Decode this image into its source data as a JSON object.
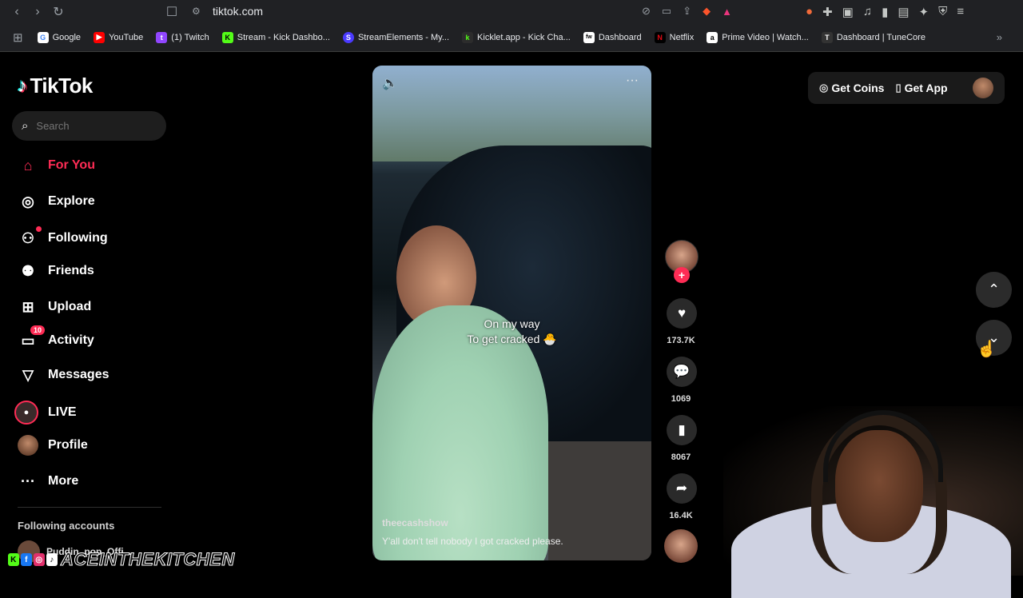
{
  "browser": {
    "url": "tiktok.com",
    "bookmarks": [
      {
        "label": "Google",
        "color": "#4285f4",
        "glyph": "G"
      },
      {
        "label": "YouTube",
        "color": "#ff0000",
        "glyph": "▶"
      },
      {
        "label": "(1) Twitch",
        "color": "#9146ff",
        "glyph": "t"
      },
      {
        "label": "Stream - Kick Dashbo...",
        "color": "#53fc18",
        "glyph": "K"
      },
      {
        "label": "StreamElements - My...",
        "color": "#4a3aff",
        "glyph": "S"
      },
      {
        "label": "Kicklet.app - Kick Cha...",
        "color": "#2c2c2c",
        "glyph": "k"
      },
      {
        "label": "Dashboard",
        "color": "#ffffff",
        "glyph": "fw"
      },
      {
        "label": "Netflix",
        "color": "#e50914",
        "glyph": "N"
      },
      {
        "label": "Prime Video | Watch...",
        "color": "#ffffff",
        "glyph": "a"
      },
      {
        "label": "Dashboard | TuneCore",
        "color": "#333333",
        "glyph": "T"
      }
    ]
  },
  "tiktok": {
    "logo": "TikTok",
    "search_placeholder": "Search",
    "nav": [
      {
        "label": "For You",
        "icon": "home-icon"
      },
      {
        "label": "Explore",
        "icon": "compass-icon"
      },
      {
        "label": "Following",
        "icon": "following-icon"
      },
      {
        "label": "Friends",
        "icon": "friends-icon"
      },
      {
        "label": "Upload",
        "icon": "upload-icon"
      },
      {
        "label": "Activity",
        "icon": "activity-icon",
        "badge": "10"
      },
      {
        "label": "Messages",
        "icon": "messages-icon"
      },
      {
        "label": "LIVE",
        "icon": "live-icon"
      },
      {
        "label": "Profile",
        "icon": "profile-icon"
      },
      {
        "label": "More",
        "icon": "more-icon"
      }
    ],
    "following_title": "Following accounts",
    "following_first": "Puddin_pop_Offi..."
  },
  "video": {
    "caption_line1": "On my way",
    "caption_line2": "To get cracked 🐣",
    "author": "theecashshow",
    "description": "Y'all don't tell nobody I got cracked please.",
    "likes": "173.7K",
    "comments": "1069",
    "saves": "8067",
    "shares": "16.4K"
  },
  "topright": {
    "coins": "Get Coins",
    "app": "Get App"
  },
  "overlay": {
    "streamer_name": "ACEINTHEKITCHEN"
  },
  "colors": {
    "accent": "#fe2c55",
    "background": "#000000"
  }
}
